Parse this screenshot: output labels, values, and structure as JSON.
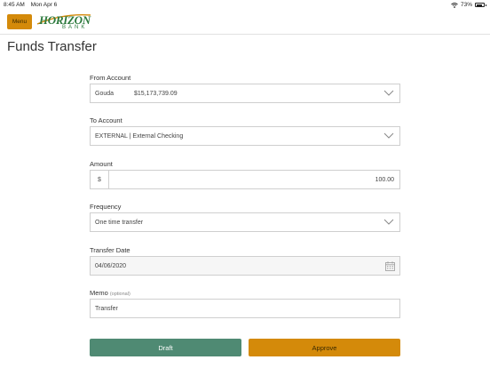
{
  "status_bar": {
    "time": "8:45 AM",
    "date": "Mon Apr 6",
    "battery": "73%",
    "battery_level": 0.73
  },
  "header": {
    "menu_label": "Menu",
    "logo_top": "HORIZON",
    "logo_bottom": "BANK"
  },
  "page": {
    "title": "Funds Transfer"
  },
  "form": {
    "from_account": {
      "label": "From Account",
      "name": "Gouda",
      "balance": "$15,173,739.09"
    },
    "to_account": {
      "label": "To Account",
      "value": "EXTERNAL | External Checking"
    },
    "amount": {
      "label": "Amount",
      "currency": "$",
      "value": "100.00"
    },
    "frequency": {
      "label": "Frequency",
      "value": "One time transfer"
    },
    "transfer_date": {
      "label": "Transfer Date",
      "value": "04/06/2020"
    },
    "memo": {
      "label": "Memo",
      "optional": "(optional)",
      "value": "Transfer"
    }
  },
  "actions": {
    "draft": "Draft",
    "approve": "Approve"
  },
  "colors": {
    "accent_orange": "#d48a0a",
    "draft_green": "#4f8a73",
    "logo_green": "#2d7a3e"
  },
  "icons": {
    "wifi": "wifi-icon",
    "battery": "battery-icon",
    "chevron": "chevron-down-icon",
    "calendar": "calendar-icon"
  }
}
